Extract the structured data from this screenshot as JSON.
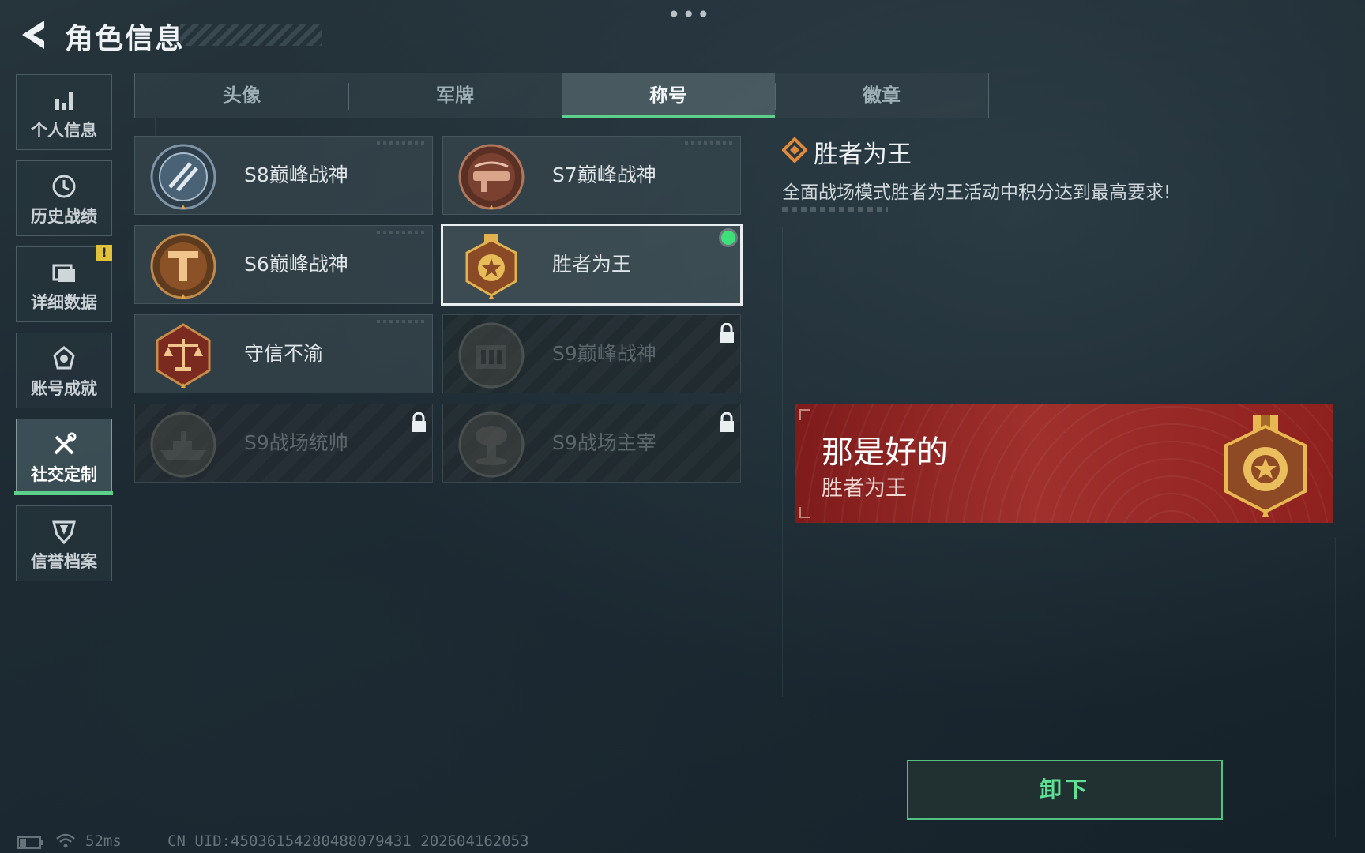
{
  "header": {
    "title": "角色信息"
  },
  "sidebar": {
    "items": [
      {
        "label": "个人信息",
        "icon": "bar-chart-icon"
      },
      {
        "label": "历史战绩",
        "icon": "clock-icon"
      },
      {
        "label": "详细数据",
        "icon": "folder-icon",
        "badge": "!"
      },
      {
        "label": "账号成就",
        "icon": "achievement-icon"
      },
      {
        "label": "社交定制",
        "icon": "tools-icon",
        "active": true
      },
      {
        "label": "信誉档案",
        "icon": "shield-icon"
      }
    ]
  },
  "tabs": [
    {
      "label": "头像"
    },
    {
      "label": "军牌"
    },
    {
      "label": "称号",
      "active": true
    },
    {
      "label": "徽章"
    }
  ],
  "titles": [
    {
      "name": "S8巅峰战神",
      "locked": false,
      "emblem": "s8-emblem-icon"
    },
    {
      "name": "S7巅峰战神",
      "locked": false,
      "emblem": "s7-emblem-icon"
    },
    {
      "name": "S6巅峰战神",
      "locked": false,
      "emblem": "s6-emblem-icon"
    },
    {
      "name": "胜者为王",
      "locked": false,
      "selected": true,
      "equipped": true,
      "emblem": "medal-icon"
    },
    {
      "name": "守信不渝",
      "locked": false,
      "emblem": "scales-icon"
    },
    {
      "name": "S9巅峰战神",
      "locked": true,
      "emblem": "s9-emblem-icon"
    },
    {
      "name": "S9战场统帅",
      "locked": true,
      "emblem": "warship-icon"
    },
    {
      "name": "S9战场主宰",
      "locked": true,
      "emblem": "mushroom-cloud-icon"
    }
  ],
  "detail": {
    "title": "胜者为王",
    "description": "全面战场模式胜者为王活动中积分达到最高要求!"
  },
  "banner": {
    "player_name": "那是好的",
    "title": "胜者为王"
  },
  "action": {
    "unequip_label": "卸下"
  },
  "status_bar": {
    "ping": "52ms",
    "uid": "CN UID:450361542804880794​31 202604162053"
  },
  "colors": {
    "accent": "#5ccf8a",
    "banner": "#a0302c",
    "gold": "#d9a84a",
    "bronze": "#9a5a2e"
  }
}
